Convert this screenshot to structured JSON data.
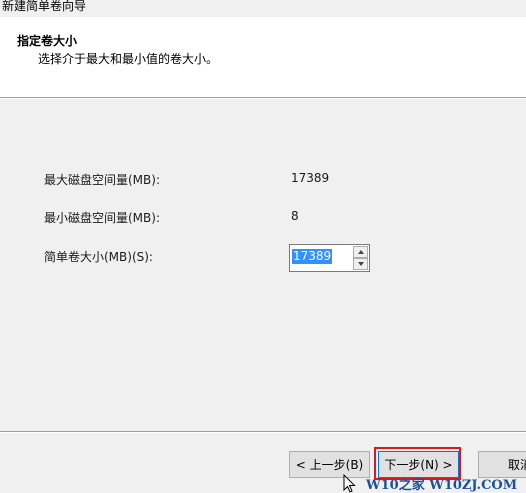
{
  "window": {
    "title": "新建简单卷向导"
  },
  "header": {
    "title": "指定卷大小",
    "subtitle": "选择介于最大和最小值的卷大小。"
  },
  "fields": {
    "max_label": "最大磁盘空间量(MB):",
    "max_value": "17389",
    "min_label": "最小磁盘空间量(MB):",
    "min_value": "8",
    "size_label": "简单卷大小(MB)(S):",
    "size_value": "17389"
  },
  "buttons": {
    "back": "< 上一步(B)",
    "next": "下一步(N) >",
    "cancel": "取消"
  },
  "overlay": {
    "highlight_color": "#d9191c",
    "watermark": "W10之家 W10ZJ.COM"
  },
  "colors": {
    "accent": "#0078d7",
    "selection": "#3390ff",
    "watermark": "#1c4f9c"
  },
  "icons": {
    "cursor": "mouse-pointer-icon",
    "spin_up": "spin-up-arrow-icon",
    "spin_down": "spin-down-arrow-icon"
  }
}
